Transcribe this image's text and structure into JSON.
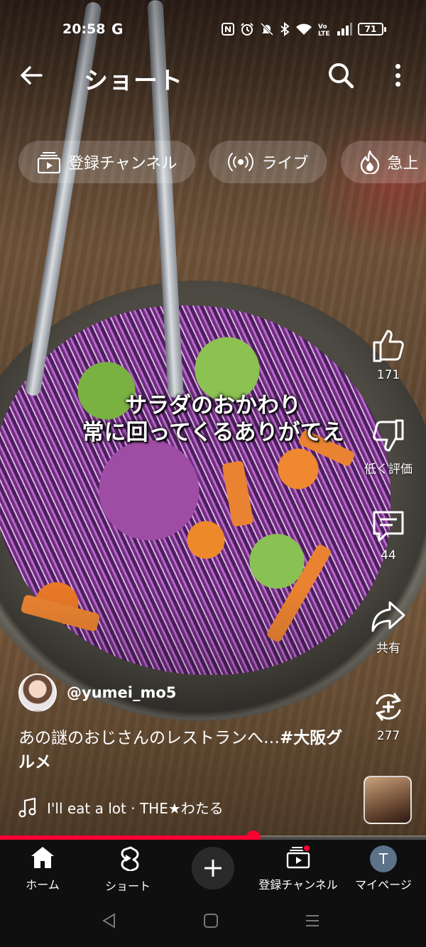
{
  "status_bar": {
    "time": "20:58",
    "google_indicator": "G",
    "battery": "71",
    "icons": [
      "nfc-icon",
      "alarm-icon",
      "mute-icon",
      "bluetooth-icon",
      "wifi-icon",
      "volte-icon",
      "signal-icon"
    ]
  },
  "header": {
    "title": "ショート",
    "back_icon": "arrow-left-icon",
    "search_icon": "search-icon",
    "more_icon": "more-vertical-icon"
  },
  "chips": [
    {
      "label": "登録チャンネル",
      "icon": "subscriptions-icon"
    },
    {
      "label": "ライブ",
      "icon": "live-icon"
    },
    {
      "label": "急上",
      "icon": "trending-icon"
    }
  ],
  "video": {
    "caption_line1": "サラダのおかわり",
    "caption_line2": "常に回ってくるありがてえ"
  },
  "actions": {
    "like_count": "171",
    "dislike_label": "低く評価",
    "comment_count": "44",
    "share_label": "共有",
    "remix_count": "277"
  },
  "channel": {
    "handle": "@yumei_mo5"
  },
  "description": {
    "text": "あの謎のおじさんのレストランへ…",
    "hashtag": "#大阪グルメ"
  },
  "music": {
    "track": "I'll eat a lot · THE★わたる"
  },
  "progress": {
    "fraction": 0.595
  },
  "bottom_nav": {
    "home": "ホーム",
    "shorts": "ショート",
    "subscriptions": "登録チャンネル",
    "you": "マイページ",
    "avatar_letter": "T"
  },
  "colors": {
    "accent": "#ff0033",
    "nav_bg": "#0f0f0f",
    "avatar_bg": "#5b7289"
  }
}
